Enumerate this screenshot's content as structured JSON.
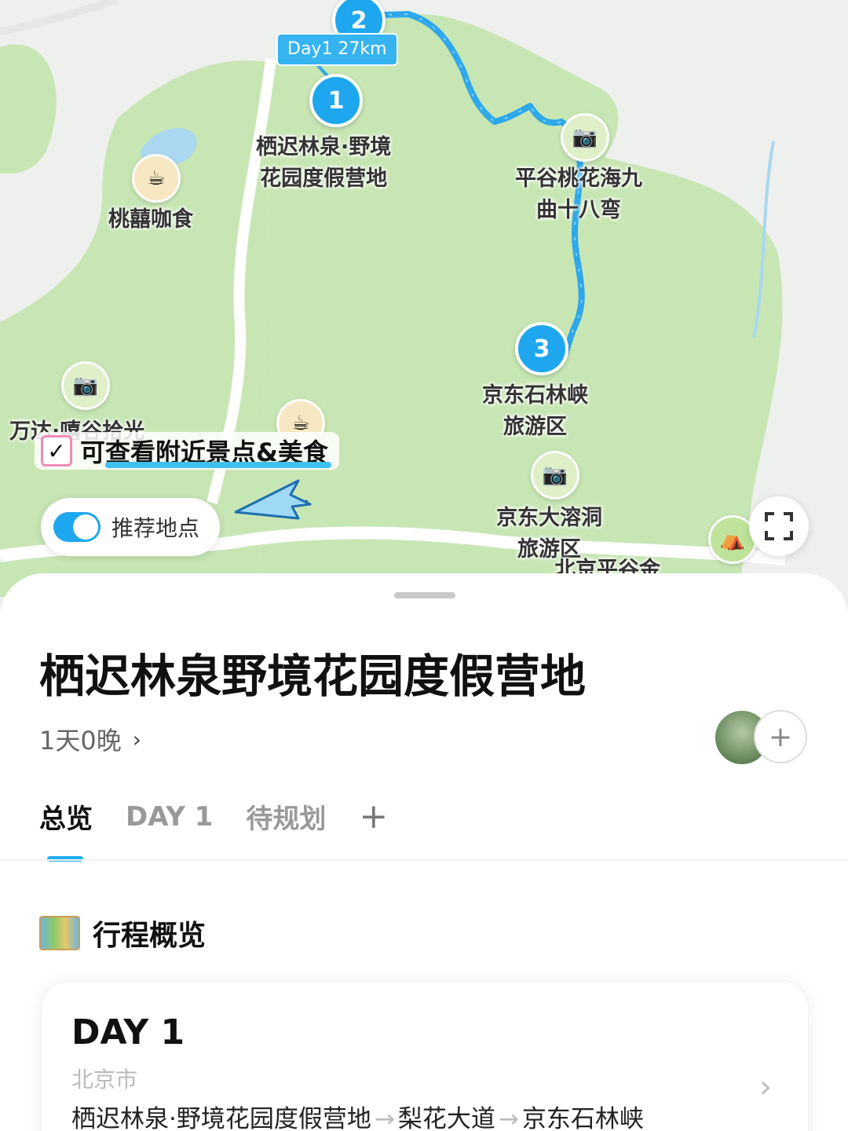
{
  "map": {
    "day_badge": "Day1 27km",
    "markers": [
      "1",
      "2",
      "3"
    ],
    "pois": [
      {
        "name": "栖迟林泉·野境\n花园度假营地",
        "icon": "marker-1"
      },
      {
        "name": "平谷桃花海九\n曲十八弯",
        "icon": "camera-icon"
      },
      {
        "name": "桃囍咖食",
        "icon": "coffee-icon"
      },
      {
        "name": "京东石林峡\n旅游区",
        "icon": "marker-3"
      },
      {
        "name": "万达·嘻谷拾光",
        "icon": "camera-icon"
      },
      {
        "name": "京东大溶洞\n旅游区",
        "icon": "camera-icon"
      },
      {
        "name": "北京平谷金",
        "icon": "tent-icon"
      }
    ],
    "annotation": "可查看附近景点&美食",
    "toggle_label": "推荐地点",
    "toggle_on": true
  },
  "sheet": {
    "title": "栖迟林泉野境花园度假营地",
    "duration": "1天0晚",
    "tabs": [
      "总览",
      "DAY 1",
      "待规划",
      "+"
    ],
    "active_tab": "总览",
    "section_title": "行程概览",
    "day_card": {
      "title": "DAY 1",
      "city": "北京市",
      "route": [
        "栖迟林泉·野境花园度假营地",
        "梨花大道",
        "京东石林峡"
      ]
    }
  },
  "colors": {
    "accent": "#1ea7ef",
    "route": "#2ea8ea",
    "map_green": "#c8e6b4"
  }
}
